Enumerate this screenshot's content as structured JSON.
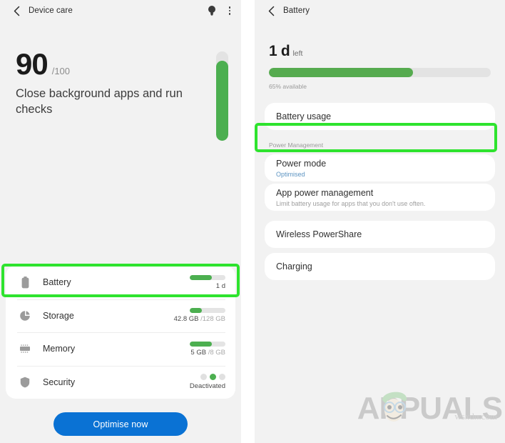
{
  "device_care": {
    "appbar": {
      "title": "Device care",
      "back_icon": "chevron-left-icon",
      "tips_icon": "lightbulb-icon",
      "more_icon": "kebab-menu-icon"
    },
    "score": {
      "value": "90",
      "denominator": "/100",
      "description": "Close background apps and run checks",
      "gauge_percent": 90,
      "gauge_color": "#4caf50"
    },
    "items": [
      {
        "label": "Battery",
        "icon": "battery-icon",
        "meter_percent": 62,
        "value": "1 d",
        "value_dim": "",
        "type": "meter",
        "highlighted": true
      },
      {
        "label": "Storage",
        "icon": "storage-pie-icon",
        "meter_percent": 34,
        "value": "42.8 GB",
        "value_dim": " /128 GB",
        "type": "meter",
        "highlighted": false
      },
      {
        "label": "Memory",
        "icon": "memory-chip-icon",
        "meter_percent": 62,
        "value": "5 GB",
        "value_dim": " /8 GB",
        "type": "meter",
        "highlighted": false
      },
      {
        "label": "Security",
        "icon": "shield-icon",
        "dots": [
          false,
          true,
          false
        ],
        "value": "Deactivated",
        "value_dim": "",
        "type": "dots",
        "highlighted": false
      }
    ],
    "cta_label": "Optimise now",
    "cta_color": "#0a72d4"
  },
  "battery": {
    "appbar": {
      "title": "Battery",
      "back_icon": "chevron-left-icon"
    },
    "remaining_value": "1 d",
    "remaining_suffix": "left",
    "bar_percent": 65,
    "available_text": "65% available",
    "usage_card": {
      "title": "Battery usage"
    },
    "section_label": "Power Management",
    "power_mode": {
      "title": "Power mode",
      "subtitle": "Optimised",
      "subtitle_color": "#5c94c2",
      "highlighted": true
    },
    "app_power": {
      "title": "App power management",
      "subtitle": "Limit battery usage for apps that you don't use often."
    },
    "powershare_card": {
      "title": "Wireless PowerShare"
    },
    "charging_card": {
      "title": "Charging"
    }
  },
  "watermark": {
    "brand": "APPUALS",
    "brand_prefix": "A",
    "brand_suffix": "PUALS",
    "url": "wsxdn.com",
    "mascot": "appuals-mascot-icon"
  },
  "highlight_color": "#2ee32e"
}
